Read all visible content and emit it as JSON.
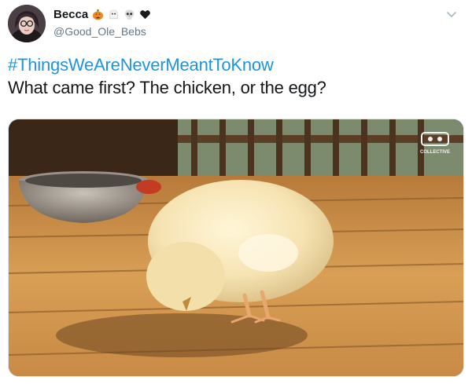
{
  "author": {
    "display_name": "Becca",
    "handle": "@Good_Ole_Bebs",
    "name_emojis": [
      "pumpkin-emoji",
      "ghost-emoji",
      "skull-emoji",
      "black-heart-emoji"
    ]
  },
  "tweet": {
    "hashtag": "#ThingsWeAreNeverMeantToKnow",
    "text": "What came first? The chicken, or the egg?"
  },
  "media": {
    "subject": "chick-photo",
    "watermark_text": "COLLECTIVE"
  },
  "colors": {
    "link": "#1b95e0",
    "text": "#14171a",
    "secondary": "#657786"
  }
}
